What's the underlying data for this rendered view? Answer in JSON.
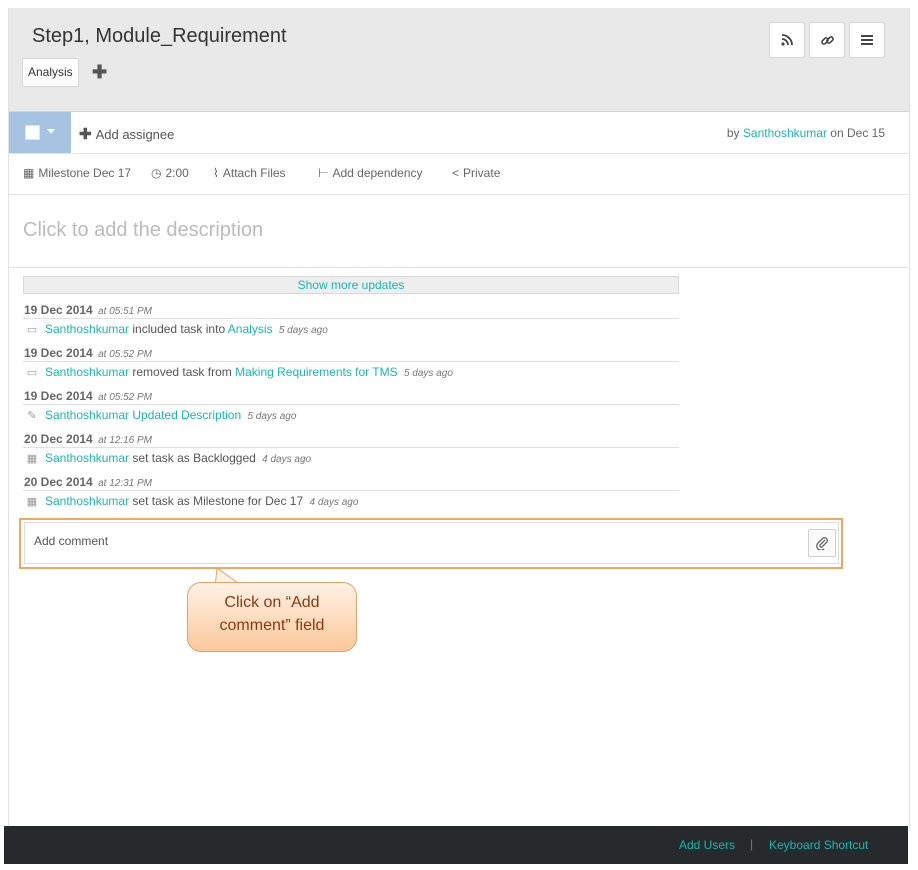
{
  "task": {
    "title": "Step1, Module_Requirement",
    "tag": "Analysis",
    "header_icons": [
      "rss-icon",
      "link-icon",
      "menu-icon"
    ]
  },
  "assign": {
    "add_assignee_label": "Add assignee",
    "by_prefix": "by",
    "author": "Santhoshkumar",
    "on_text": "on Dec 15"
  },
  "meta": {
    "milestone": "Milestone Dec 17",
    "time": "2:00",
    "attach": "Attach Files",
    "dependency": "Add dependency",
    "privacy": "Private"
  },
  "description": {
    "placeholder": "Click to add the description"
  },
  "updates": {
    "show_more": "Show more updates",
    "items": [
      {
        "date": "19 Dec 2014",
        "time": "at 05:51 PM",
        "user": "Santhoshkumar",
        "text": "included task into",
        "target": "Analysis",
        "ago": "5 days ago",
        "icon": "folder-icon"
      },
      {
        "date": "19 Dec 2014",
        "time": "at 05:52 PM",
        "user": "Santhoshkumar",
        "text": "removed task from",
        "target": "Making Requirements for TMS",
        "ago": "5 days ago",
        "icon": "folder-icon"
      },
      {
        "date": "19 Dec 2014",
        "time": "at 05:52 PM",
        "user": "Santhoshkumar",
        "text": "",
        "target": "Updated Description",
        "ago": "5 days ago",
        "icon": "pencil-icon"
      },
      {
        "date": "20 Dec 2014",
        "time": "at 12:16 PM",
        "user": "Santhoshkumar",
        "text": "set task as Backlogged",
        "target": "",
        "ago": "4 days ago",
        "icon": "calendar-icon"
      },
      {
        "date": "20 Dec 2014",
        "time": "at 12:31 PM",
        "user": "Santhoshkumar",
        "text": "set task as Milestone for Dec 17",
        "target": "",
        "ago": "4 days ago",
        "icon": "calendar-icon"
      }
    ]
  },
  "comment": {
    "placeholder": "Add comment"
  },
  "callout": {
    "line1": "Click on “Add",
    "line2": "comment” field"
  },
  "footer": {
    "add_users": "Add Users",
    "separator": "|",
    "keyboard_shortcut": "Keyboard Shortcut"
  }
}
